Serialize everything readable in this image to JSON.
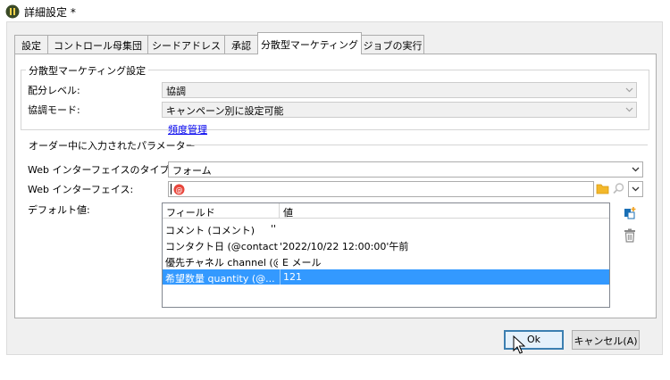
{
  "window": {
    "title": "詳細設定 *"
  },
  "tabs": [
    {
      "label": "設定"
    },
    {
      "label": "コントロール母集団"
    },
    {
      "label": "シードアドレス"
    },
    {
      "label": "承認"
    },
    {
      "label": "分散型マーケティング"
    },
    {
      "label": "ジョブの実行"
    }
  ],
  "active_tab": 4,
  "settings_group": {
    "title": "分散型マーケティング設定",
    "distribution_level": {
      "label": "配分レベル:",
      "value": "協調"
    },
    "coordination_mode": {
      "label": "協調モード:",
      "value": "キャンペーン別に設定可能"
    },
    "frequency_link": "頻度管理"
  },
  "params_group": {
    "title": "オーダー中に入力されたパラメーター",
    "web_type": {
      "label": "Web インターフェイスのタイプ:",
      "value": "フォーム"
    },
    "web_interface": {
      "label": "Web インターフェイス:",
      "value": ""
    },
    "defaults_label": "デフォルト値:",
    "grid": {
      "columns": [
        "フィールド",
        "値"
      ],
      "rows": [
        {
          "field": "コメント (コメント)",
          "value": "''"
        },
        {
          "field": "コンタクト日 (@contact...",
          "value": "'2022/10/22 12:00:00'午前"
        },
        {
          "field": "優先チャネル channel (@cha...",
          "value": "E メール"
        },
        {
          "field": "希望数量 quantity (@...",
          "value": "121",
          "selected": true
        }
      ]
    }
  },
  "buttons": {
    "ok": "Ok",
    "cancel": "キャンセル(A)"
  },
  "colors": {
    "selection": "#3399ff",
    "link": "#0000ee",
    "default_button_border": "#3c7fb1"
  }
}
